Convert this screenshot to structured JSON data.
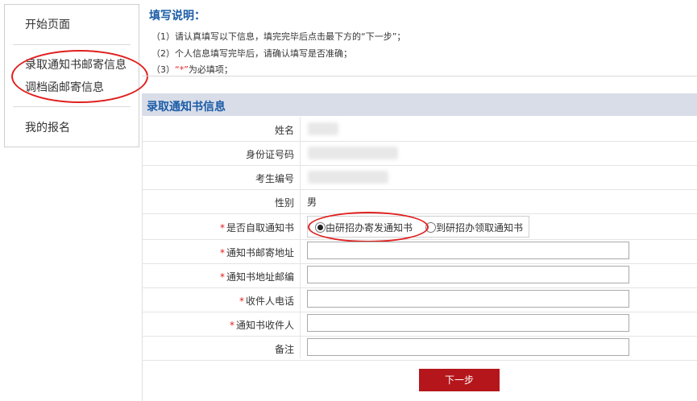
{
  "sidebar": {
    "items": [
      {
        "label": "开始页面"
      },
      {
        "label": "录取通知书邮寄信息"
      },
      {
        "label": "调档函邮寄信息"
      },
      {
        "label": "我的报名"
      }
    ]
  },
  "instructions": {
    "title": "填写说明：",
    "line1": "（1）请认真填写以下信息，填完完毕后点击最下方的“下一步”；",
    "line2": "（2）个人信息填写完毕后，请确认填写是否准确；",
    "line3_prefix": "（3）",
    "line3_red": "“*”",
    "line3_suffix": "为必填项；"
  },
  "form": {
    "section_title": "录取通知书信息",
    "fields": {
      "name_label": "姓名",
      "id_label": "身份证号码",
      "exam_no_label": "考生编号",
      "gender_label": "性别",
      "gender_value": "男",
      "pickup_label": "是否自取通知书",
      "pickup_option1": "由研招办寄发通知书",
      "pickup_option2": "到研招办领取通知书",
      "address_label": "通知书邮寄地址",
      "zip_label": "通知书地址邮编",
      "phone_label": "收件人电话",
      "recipient_label": "通知书收件人",
      "note_label": "备注"
    },
    "required_mark": "*",
    "next_label": "下一步"
  },
  "colors": {
    "accent_blue": "#1b5ca8",
    "header_bg": "#d9dde8",
    "button_red": "#b5161b",
    "annotation_red": "#e02020"
  }
}
